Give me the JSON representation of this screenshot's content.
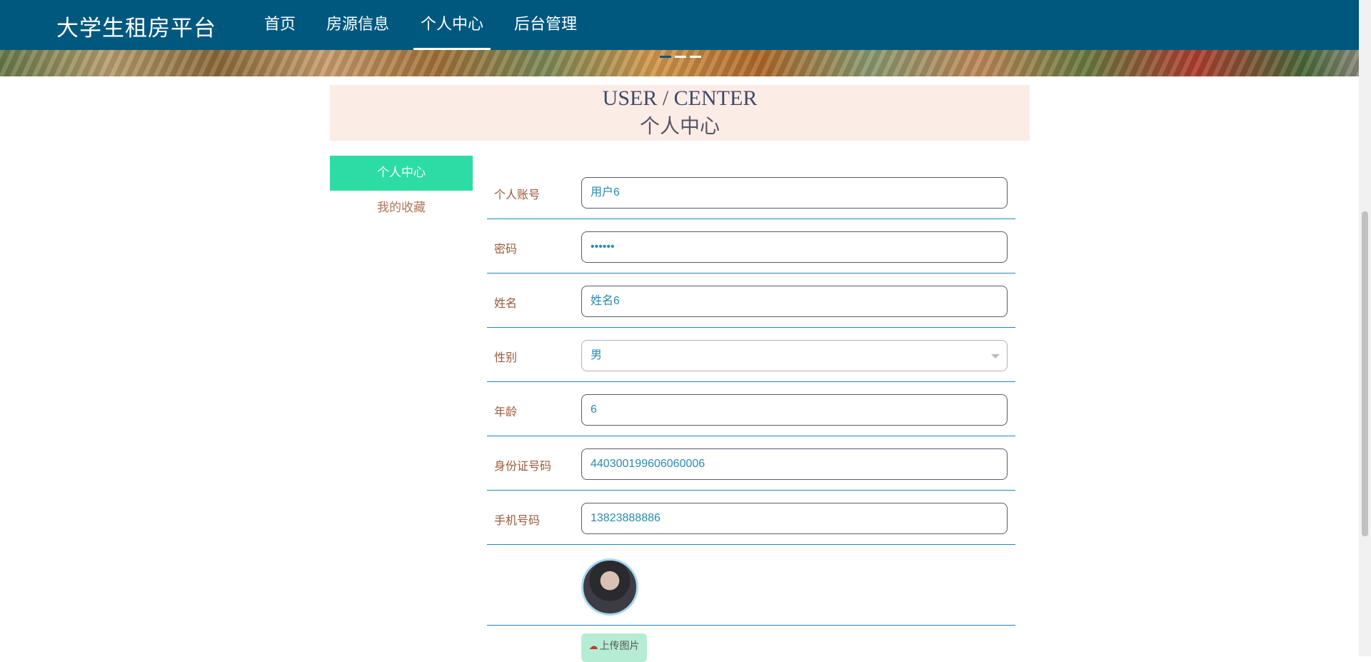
{
  "brand": "大学生租房平台",
  "nav": {
    "items": [
      {
        "label": "首页",
        "active": false
      },
      {
        "label": "房源信息",
        "active": false
      },
      {
        "label": "个人中心",
        "active": true
      },
      {
        "label": "后台管理",
        "active": false
      }
    ]
  },
  "header": {
    "title_en": "USER / CENTER",
    "title_zh": "个人中心"
  },
  "side_menu": {
    "items": [
      {
        "label": "个人中心",
        "active": true
      },
      {
        "label": "我的收藏",
        "active": false
      }
    ]
  },
  "form": {
    "fields": [
      {
        "label": "个人账号",
        "value": "用户6"
      },
      {
        "label": "密码",
        "value": "••••••"
      },
      {
        "label": "姓名",
        "value": "姓名6"
      },
      {
        "label": "性别",
        "value": "男",
        "type": "select"
      },
      {
        "label": "年龄",
        "value": "6"
      },
      {
        "label": "身份证号码",
        "value": "440300199606060006"
      },
      {
        "label": "手机号码",
        "value": "13823888886"
      }
    ],
    "upload_label": "上传图片",
    "upload_icon": "cloud-upload-icon"
  },
  "colors": {
    "nav_bg": "#00587f",
    "active_menu": "#2ddca5",
    "header_bg": "#fcece6",
    "divider": "#1d8bb8",
    "upload_bg": "#b7ecd4"
  }
}
